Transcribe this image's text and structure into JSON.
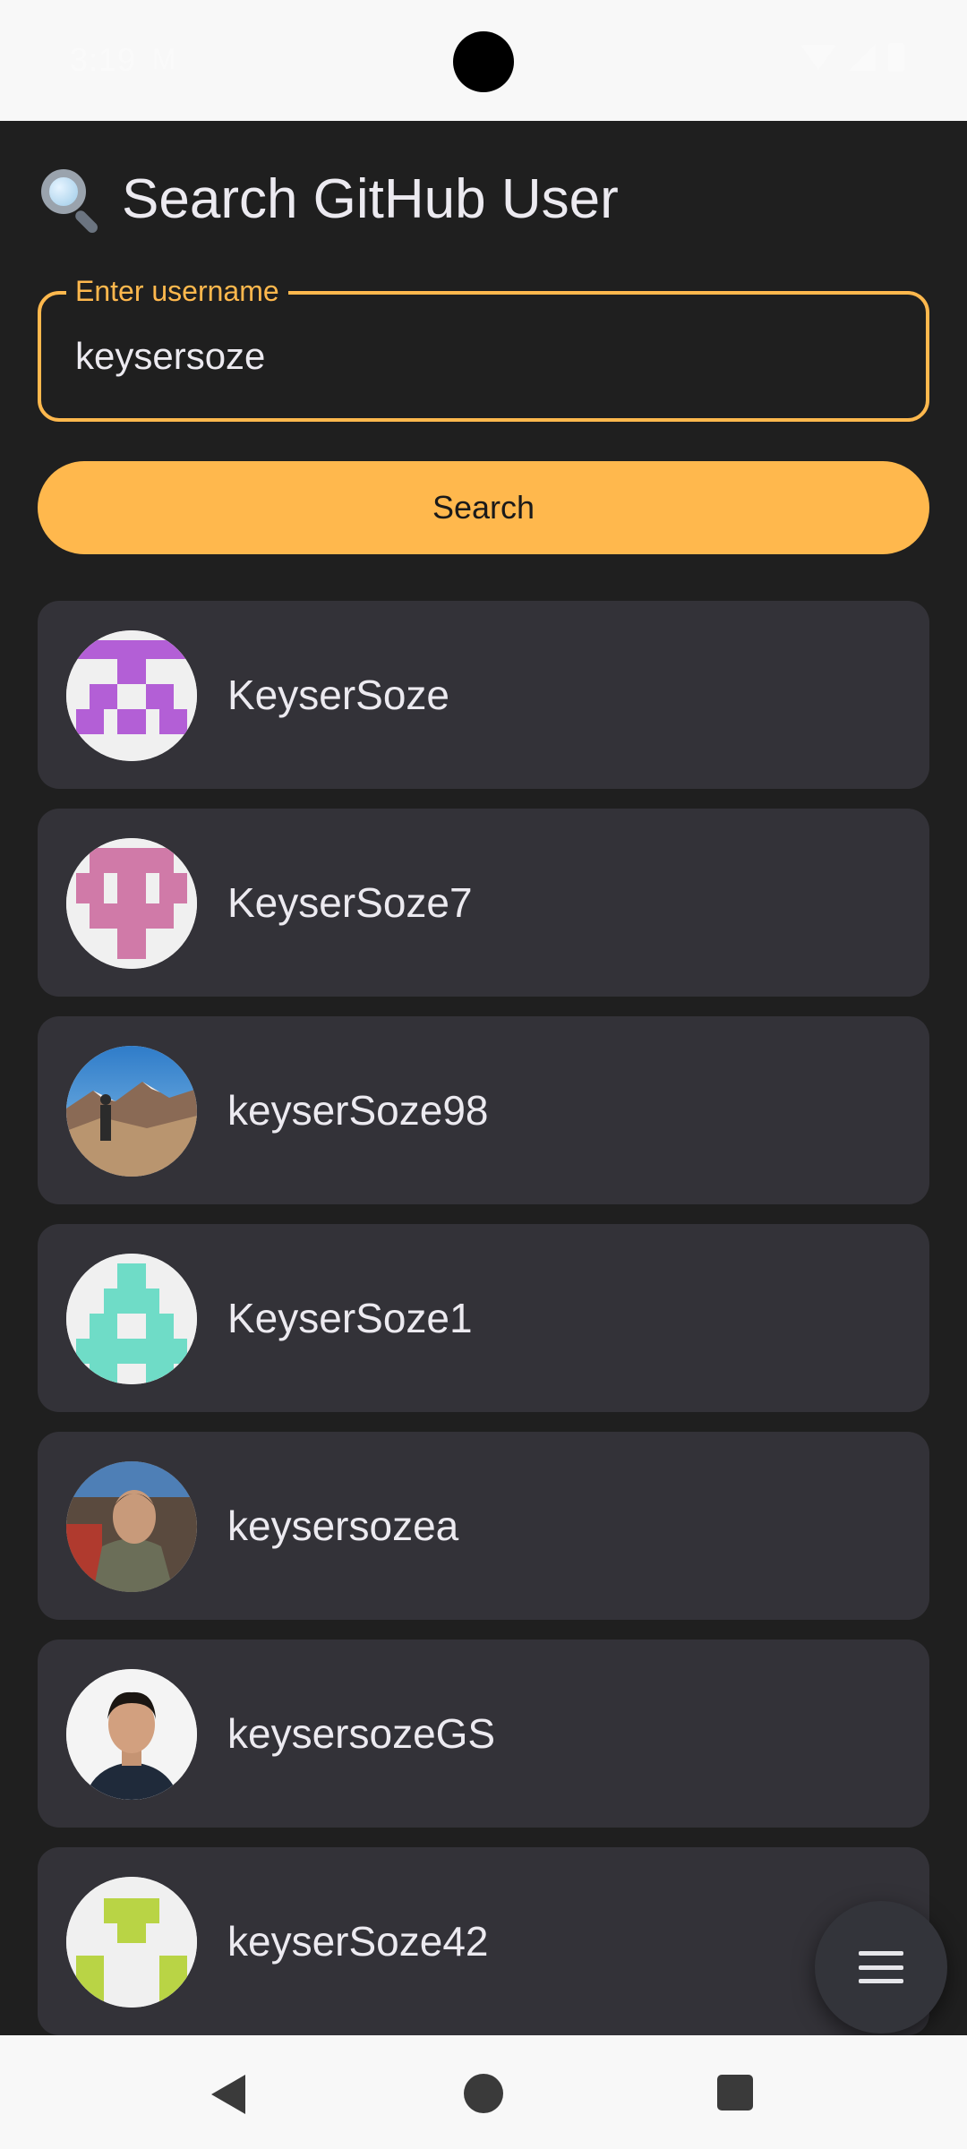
{
  "status_bar": {
    "time": "3:19",
    "mail_glyph": "M"
  },
  "header": {
    "icon": "magnifying-glass-icon",
    "title": "Search GitHub User"
  },
  "search": {
    "label": "Enter username",
    "value": "keysersoze",
    "button_label": "Search"
  },
  "results": [
    {
      "username": "KeyserSoze",
      "avatar": "identicon-purple"
    },
    {
      "username": "KeyserSoze7",
      "avatar": "identicon-pink"
    },
    {
      "username": "keyserSoze98",
      "avatar": "photo-mountain"
    },
    {
      "username": "KeyserSoze1",
      "avatar": "identicon-teal"
    },
    {
      "username": "keysersozea",
      "avatar": "photo-man"
    },
    {
      "username": "keysersozeGS",
      "avatar": "photo-portrait"
    },
    {
      "username": "keyserSoze42",
      "avatar": "identicon-lime"
    }
  ],
  "fab": {
    "icon": "menu-icon"
  },
  "colors": {
    "accent": "#ffb84d",
    "card": "#333238",
    "background": "#1f1f1f"
  }
}
